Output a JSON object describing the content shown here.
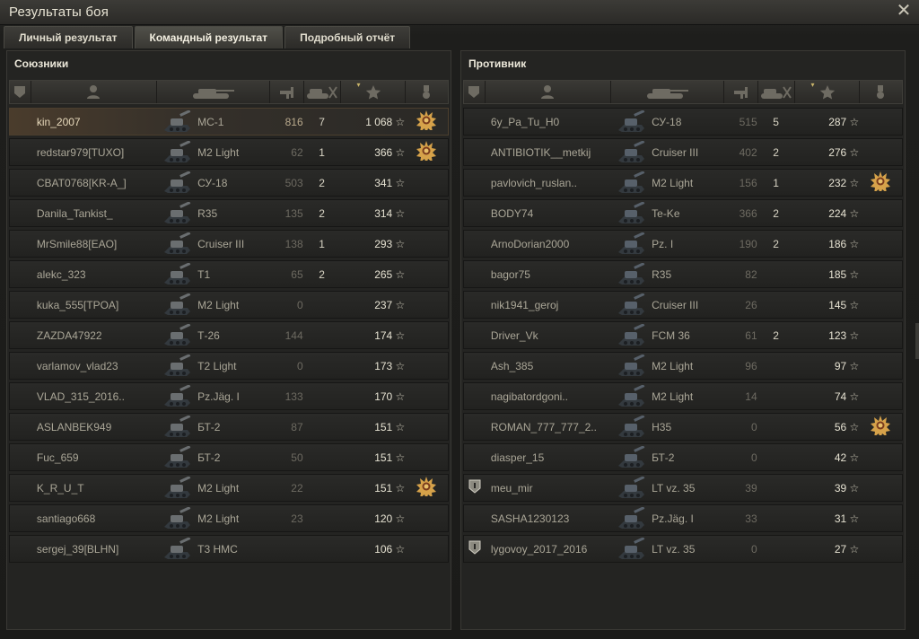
{
  "window": {
    "title": "Результаты боя",
    "close_glyph": "✕"
  },
  "tabs": [
    {
      "label": "Личный результат",
      "active": false
    },
    {
      "label": "Командный результат",
      "active": true
    },
    {
      "label": "Подробный отчёт",
      "active": false
    }
  ],
  "icons": {
    "header": [
      "platoon-icon",
      "player-icon",
      "tank-icon",
      "damage-icon",
      "frags-icon",
      "xp-star-icon",
      "medal-icon"
    ],
    "sort_marker": "▾",
    "star_glyph": "☆"
  },
  "colors": {
    "accent": "#c9b46a",
    "player_row": "#4a3c2c",
    "medal": "#d6a24a"
  },
  "allies": {
    "title": "Союзники",
    "rows": [
      {
        "name": "kin_2007",
        "vehicle": "МС-1",
        "damage": "816",
        "frags": "7",
        "xp": "1 068",
        "medal": true,
        "player": true,
        "badge": false
      },
      {
        "name": "redstar979[TUXO]",
        "vehicle": "M2 Light",
        "damage": "62",
        "frags": "1",
        "xp": "366",
        "medal": true,
        "player": false,
        "badge": false
      },
      {
        "name": "CBAT0768[KR-A_]",
        "vehicle": "СУ-18",
        "damage": "503",
        "frags": "2",
        "xp": "341",
        "medal": false,
        "player": false,
        "badge": false
      },
      {
        "name": "Danila_Tankist_",
        "vehicle": "R35",
        "damage": "135",
        "frags": "2",
        "xp": "314",
        "medal": false,
        "player": false,
        "badge": false
      },
      {
        "name": "MrSmile88[EAO]",
        "vehicle": "Cruiser III",
        "damage": "138",
        "frags": "1",
        "xp": "293",
        "medal": false,
        "player": false,
        "badge": false
      },
      {
        "name": "alekc_323",
        "vehicle": "T1",
        "damage": "65",
        "frags": "2",
        "xp": "265",
        "medal": false,
        "player": false,
        "badge": false
      },
      {
        "name": "kuka_555[TPOA]",
        "vehicle": "M2 Light",
        "damage": "0",
        "frags": "",
        "xp": "237",
        "medal": false,
        "player": false,
        "badge": false
      },
      {
        "name": "ZAZDA47922",
        "vehicle": "Т-26",
        "damage": "144",
        "frags": "",
        "xp": "174",
        "medal": false,
        "player": false,
        "badge": false
      },
      {
        "name": "varlamov_vlad23",
        "vehicle": "T2 Light",
        "damage": "0",
        "frags": "",
        "xp": "173",
        "medal": false,
        "player": false,
        "badge": false
      },
      {
        "name": "VLAD_315_2016..",
        "vehicle": "Pz.Jäg. I",
        "damage": "133",
        "frags": "",
        "xp": "170",
        "medal": false,
        "player": false,
        "badge": false
      },
      {
        "name": "ASLANBEK949",
        "vehicle": "БТ-2",
        "damage": "87",
        "frags": "",
        "xp": "151",
        "medal": false,
        "player": false,
        "badge": false
      },
      {
        "name": "Fuc_659",
        "vehicle": "БТ-2",
        "damage": "50",
        "frags": "",
        "xp": "151",
        "medal": false,
        "player": false,
        "badge": false
      },
      {
        "name": "K_R_U_T",
        "vehicle": "M2 Light",
        "damage": "22",
        "frags": "",
        "xp": "151",
        "medal": true,
        "player": false,
        "badge": false
      },
      {
        "name": "santiago668",
        "vehicle": "M2 Light",
        "damage": "23",
        "frags": "",
        "xp": "120",
        "medal": false,
        "player": false,
        "badge": false
      },
      {
        "name": "sergej_39[BLHN]",
        "vehicle": "T3 HMC",
        "damage": "",
        "frags": "",
        "xp": "106",
        "medal": false,
        "player": false,
        "badge": false
      }
    ]
  },
  "enemies": {
    "title": "Противник",
    "rows": [
      {
        "name": "6y_Pa_Tu_H0",
        "vehicle": "СУ-18",
        "damage": "515",
        "frags": "5",
        "xp": "287",
        "medal": false,
        "badge": false
      },
      {
        "name": "ANTIBIOTIK__metkij",
        "vehicle": "Cruiser III",
        "damage": "402",
        "frags": "2",
        "xp": "276",
        "medal": false,
        "badge": false
      },
      {
        "name": "pavlovich_ruslan..",
        "vehicle": "M2 Light",
        "damage": "156",
        "frags": "1",
        "xp": "232",
        "medal": true,
        "badge": false
      },
      {
        "name": "BODY74",
        "vehicle": "Te-Ke",
        "damage": "366",
        "frags": "2",
        "xp": "224",
        "medal": false,
        "badge": false
      },
      {
        "name": "ArnoDorian2000",
        "vehicle": "Pz. I",
        "damage": "190",
        "frags": "2",
        "xp": "186",
        "medal": false,
        "badge": false
      },
      {
        "name": "bagor75",
        "vehicle": "R35",
        "damage": "82",
        "frags": "",
        "xp": "185",
        "medal": false,
        "badge": false
      },
      {
        "name": "nik1941_geroj",
        "vehicle": "Cruiser III",
        "damage": "26",
        "frags": "",
        "xp": "145",
        "medal": false,
        "badge": false
      },
      {
        "name": "Driver_Vk",
        "vehicle": "FCM 36",
        "damage": "61",
        "frags": "2",
        "xp": "123",
        "medal": false,
        "badge": false
      },
      {
        "name": "Ash_385",
        "vehicle": "M2 Light",
        "damage": "96",
        "frags": "",
        "xp": "97",
        "medal": false,
        "badge": false
      },
      {
        "name": "nagibatordgoni..",
        "vehicle": "M2 Light",
        "damage": "14",
        "frags": "",
        "xp": "74",
        "medal": false,
        "badge": false
      },
      {
        "name": "ROMAN_777_777_2..",
        "vehicle": "H35",
        "damage": "0",
        "frags": "",
        "xp": "56",
        "medal": true,
        "badge": false
      },
      {
        "name": "diasper_15",
        "vehicle": "БТ-2",
        "damage": "0",
        "frags": "",
        "xp": "42",
        "medal": false,
        "badge": false
      },
      {
        "name": "meu_mir",
        "vehicle": "LT vz. 35",
        "damage": "39",
        "frags": "",
        "xp": "39",
        "medal": false,
        "badge": true
      },
      {
        "name": "SASHA1230123",
        "vehicle": "Pz.Jäg. I",
        "damage": "33",
        "frags": "",
        "xp": "31",
        "medal": false,
        "badge": false
      },
      {
        "name": "lygovoy_2017_2016",
        "vehicle": "LT vz. 35",
        "damage": "0",
        "frags": "",
        "xp": "27",
        "medal": false,
        "badge": true
      }
    ]
  }
}
